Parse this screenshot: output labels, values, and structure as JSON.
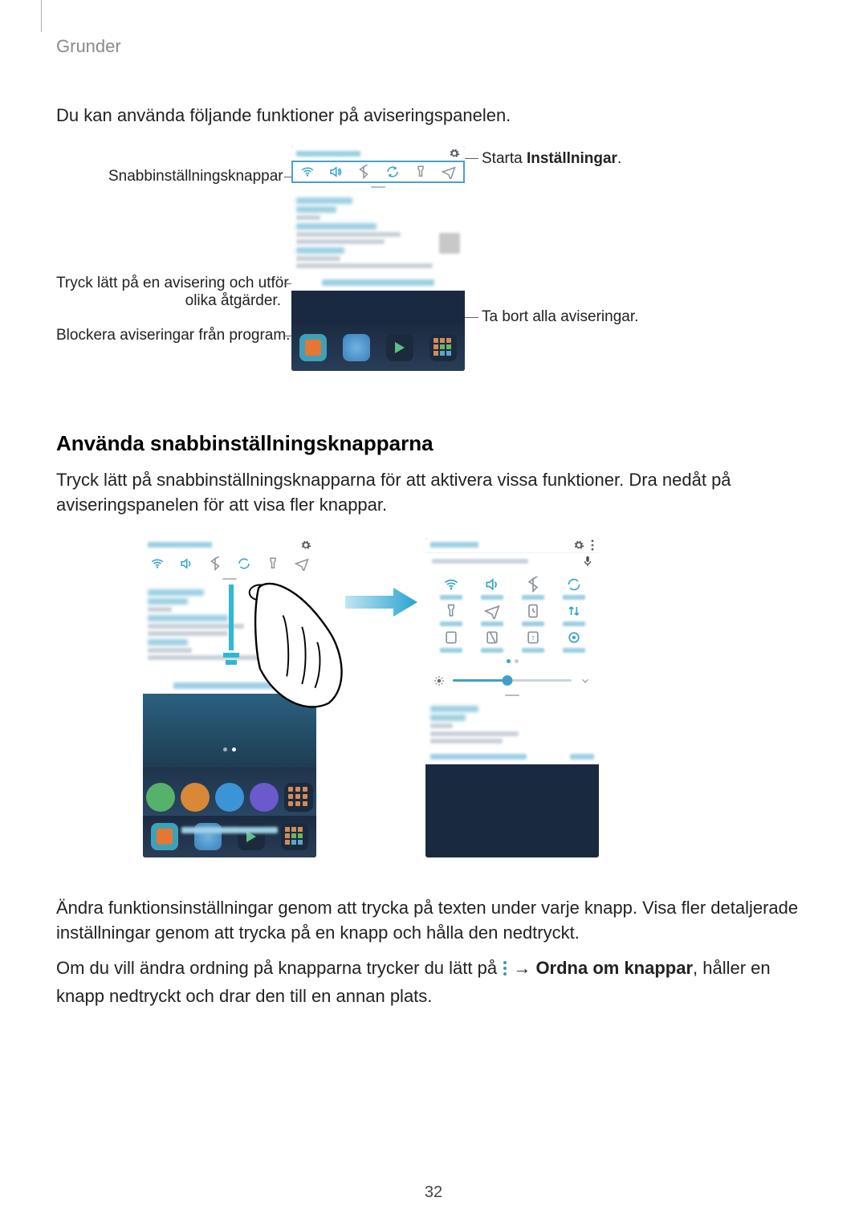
{
  "breadcrumb": "Grunder",
  "intro": "Du kan använda följande funktioner på aviseringspanelen.",
  "fig1": {
    "labels": {
      "quick_settings_buttons": "Snabbinställningsknappar",
      "tap_notif_line1": "Tryck lätt på en avisering och utför",
      "tap_notif_line2": "olika åtgärder.",
      "block_notifs": "Blockera aviseringar från program.",
      "start_settings_pre": "Starta ",
      "start_settings_bold": "Inställningar",
      "start_settings_post": ".",
      "clear_all": "Ta bort alla aviseringar."
    }
  },
  "section2": {
    "heading": "Använda snabbinställningsknapparna",
    "paragraph": "Tryck lätt på snabbinställningsknapparna för att aktivera vissa funktioner. Dra nedåt på aviseringspanelen för att visa fler knappar."
  },
  "para3": "Ändra funktionsinställningar genom att trycka på texten under varje knapp. Visa fler detaljerade inställningar genom att trycka på en knapp och hålla den nedtryckt.",
  "para4_pre": "Om du vill ändra ordning på knapparna trycker du lätt på ",
  "para4_arrow": " → ",
  "para4_bold": "Ordna om knappar",
  "para4_post": ", håller en knapp nedtryckt och drar den till en annan plats.",
  "page_number": "32"
}
